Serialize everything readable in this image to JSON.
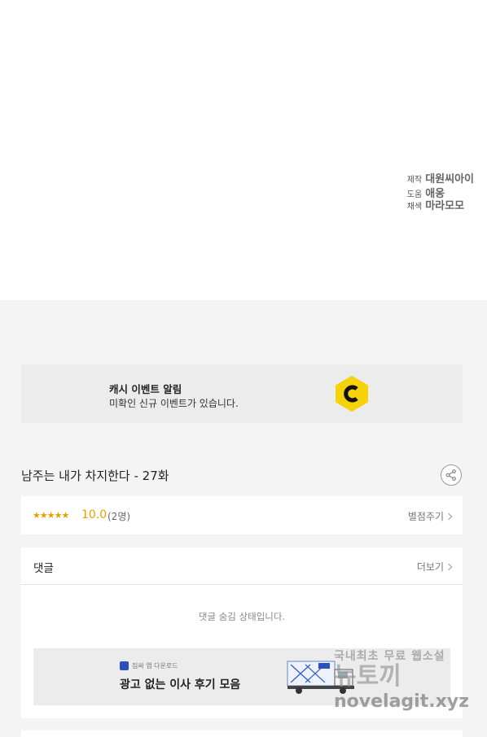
{
  "credits": [
    {
      "role": "제작",
      "name": "대원씨아이"
    },
    {
      "role": "도움",
      "name": "애옹"
    },
    {
      "role": "채색",
      "name": "마라모모"
    }
  ],
  "event_banner": {
    "title": "캐시 이벤트 알림",
    "description": "미확인 신규 이벤트가 있습니다.",
    "logo_letter": "C",
    "logo_color": "#f5d20a"
  },
  "episode": {
    "title": "남주는 내가 차지한다 - 27화"
  },
  "rating": {
    "stars": "★★★★★",
    "score": "10.0",
    "count": "(2명)",
    "rate_button": "별점주기",
    "accent": "#e8a000"
  },
  "comments": {
    "title": "댓글",
    "more": "더보기",
    "hidden_message": "댓글 숨김 상태입니다."
  },
  "ad": {
    "brand": "짐싸 앱 다운로드",
    "text": "광고 없는 이사 후기 모음",
    "brand_color": "#2b4fbf",
    "truck_label": "짐싸"
  },
  "watermark": {
    "line1": "국내최초 무료 웹소설",
    "line2": "뉴토끼",
    "line3": "novelagit.xyz"
  }
}
